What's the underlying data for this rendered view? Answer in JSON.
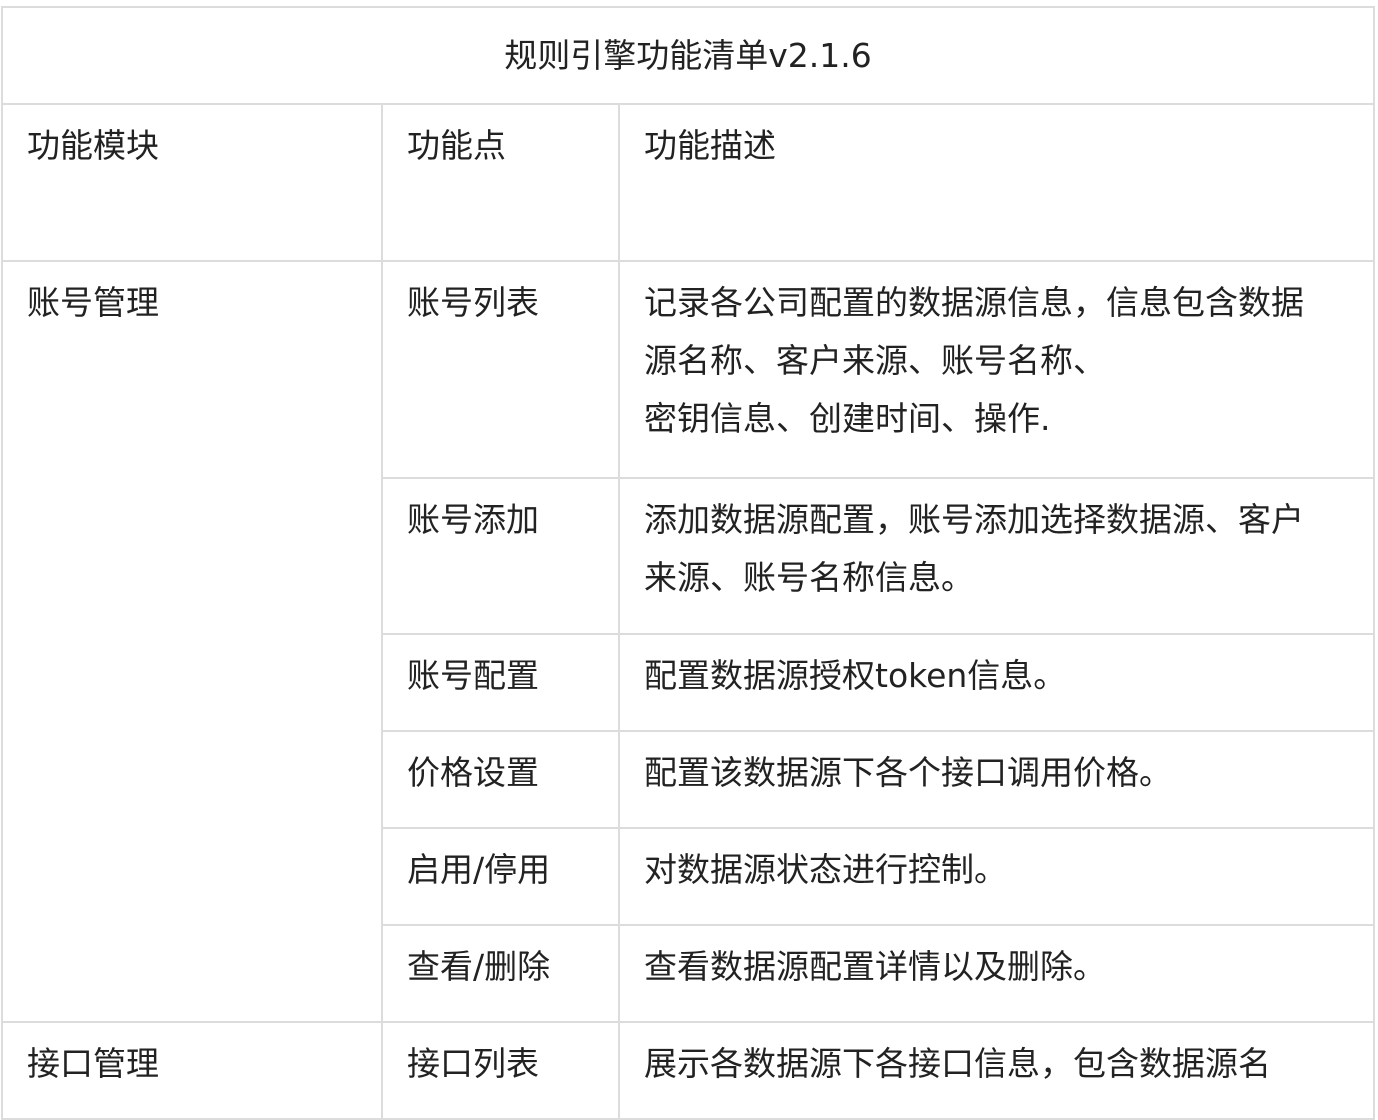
{
  "table": {
    "title": "规则引擎功能清单v2.1.6",
    "headers": {
      "module": "功能模块",
      "feature": "功能点",
      "description": "功能描述"
    },
    "rows": [
      {
        "module": "账号管理",
        "feature": "账号列表",
        "description_lines": [
          "记录各公司配置的数据源信息，信息包含数据",
          "源名称、客户来源、账号名称、",
          "密钥信息、创建时间、操作."
        ]
      },
      {
        "feature": "账号添加",
        "description_lines": [
          "添加数据源配置，账号添加选择数据源、客户",
          "来源、账号名称信息。"
        ]
      },
      {
        "feature": "账号配置",
        "description_lines": [
          "配置数据源授权token信息。"
        ]
      },
      {
        "feature": "价格设置",
        "description_lines": [
          "配置该数据源下各个接口调用价格。"
        ]
      },
      {
        "feature": "启用/停用",
        "description_lines": [
          "对数据源状态进行控制。"
        ]
      },
      {
        "feature": "查看/删除",
        "description_lines": [
          "查看数据源配置详情以及删除。"
        ]
      },
      {
        "module": "接口管理",
        "feature": "接口列表",
        "description_lines": [
          "展示各数据源下各接口信息，包含数据源名"
        ]
      }
    ]
  }
}
